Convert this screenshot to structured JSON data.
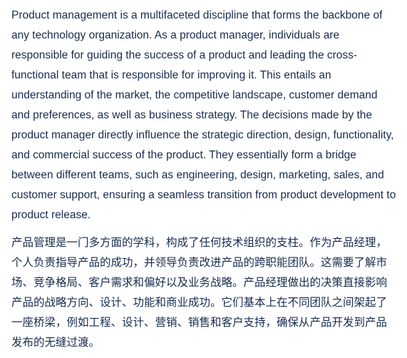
{
  "document": {
    "paragraph_en": "Product management is a multifaceted discipline that forms the backbone of any technology organization. As a product manager, individuals are responsible for guiding the success of a product and leading the cross-functional team that is responsible for improving it. This entails an understanding of the market, the competitive landscape, customer demand and preferences, as well as business strategy. The decisions made by the product manager directly influence the strategic direction, design, functionality, and commercial success of the product. They essentially form a bridge between different teams, such as engineering, design, marketing, sales, and customer support, ensuring a seamless transition from product development to product release.",
    "paragraph_zh": "产品管理是一门多方面的学科，构成了任何技术组织的支柱。作为产品经理，个人负责指导产品的成功，并领导负责改进产品的跨职能团队。这需要了解市场、竞争格局、客户需求和偏好以及业务战略。产品经理做出的决策直接影响产品的战略方向、设计、功能和商业成功。它们基本上在不同团队之间架起了一座桥梁，例如工程、设计、营销、销售和客户支持，确保从产品开发到产品发布的无缝过渡。"
  }
}
